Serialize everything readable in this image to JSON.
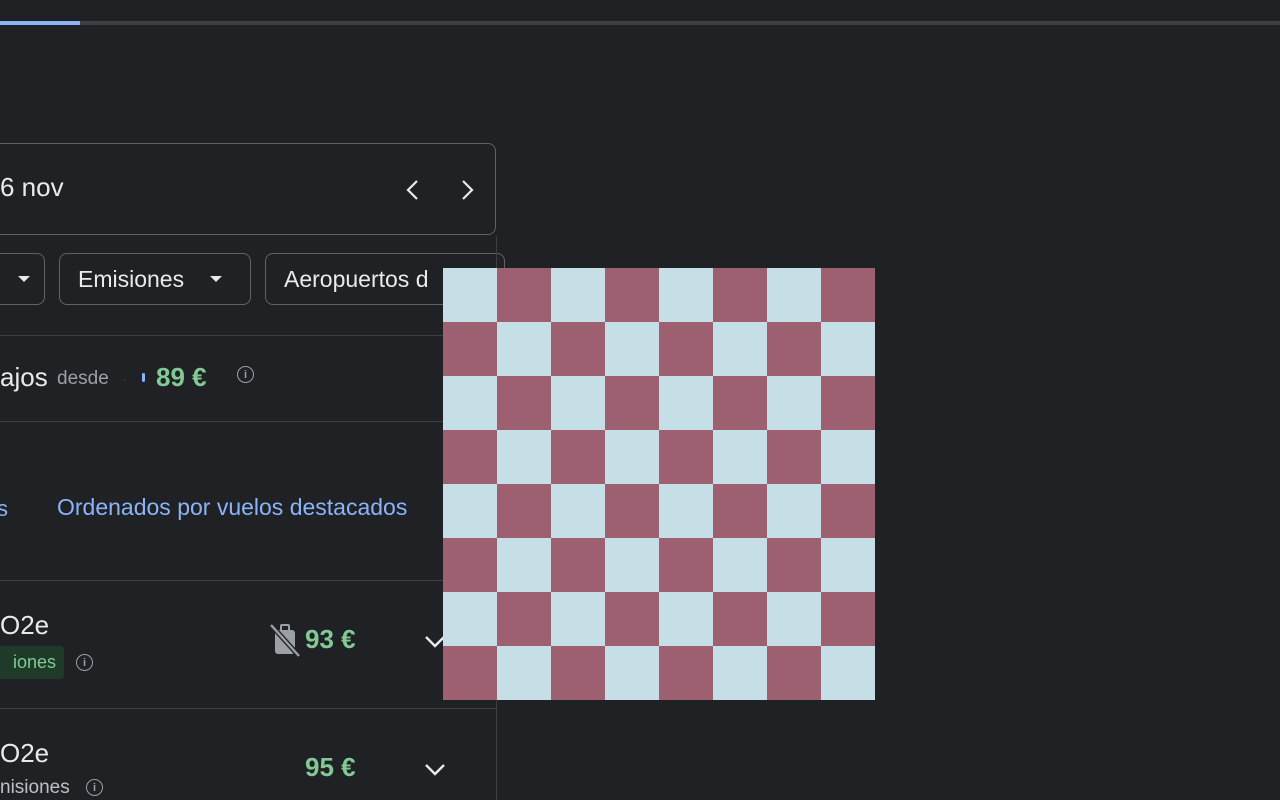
{
  "progress": {
    "fraction": 0.0625
  },
  "date_selector": {
    "date_text": "6 nov"
  },
  "filters": {
    "emissions_label": "Emisiones",
    "airports_label": "Aeropuertos d"
  },
  "price_header": {
    "title": "ajos",
    "from_label": "desde",
    "separator": "·",
    "price": "89 €"
  },
  "sort": {
    "left_fragment": "s",
    "link_label": "Ordenados por vuelos destacados"
  },
  "results": [
    {
      "co2": "O2e",
      "badge": "iones",
      "price": "93 €"
    },
    {
      "co2": "O2e",
      "emissions_text": "nisiones",
      "price": "95 €"
    }
  ],
  "overlay": {
    "rows": 8,
    "cols": 8,
    "colors": {
      "light": "#c6dee5",
      "dark": "#9c6070"
    }
  },
  "colors": {
    "background": "#202124",
    "accent_blue": "#8ab4f8",
    "price_green": "#81c995"
  }
}
